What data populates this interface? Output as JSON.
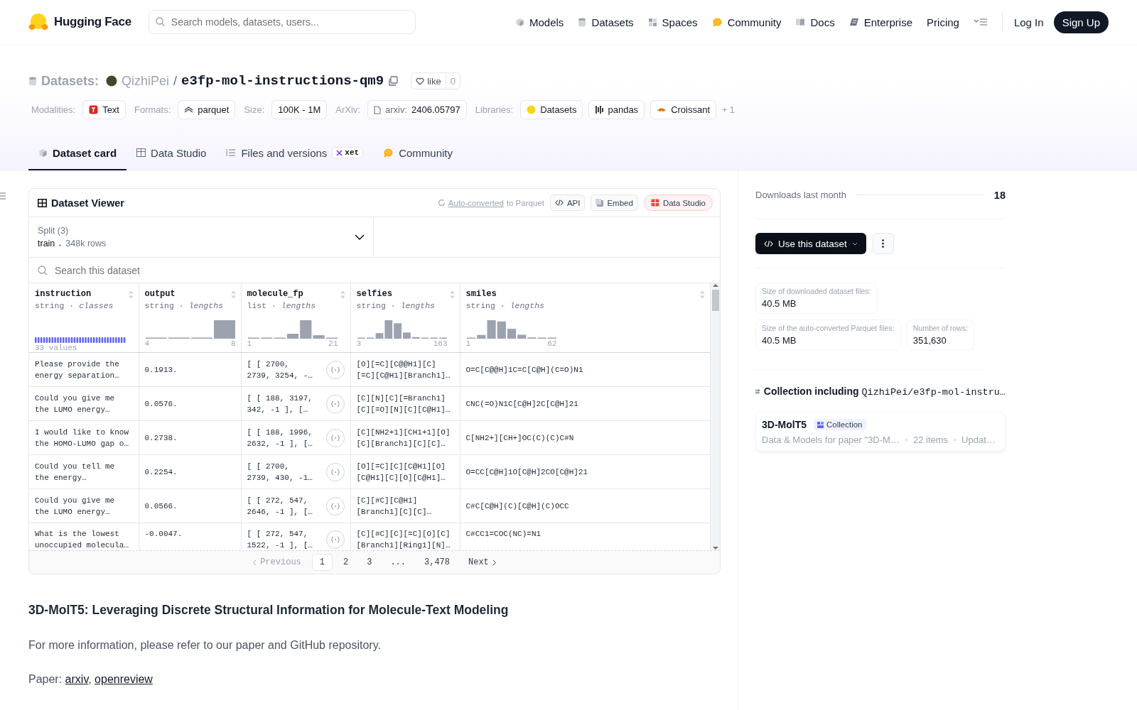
{
  "nav": {
    "logo": "Hugging Face",
    "search": {
      "placeholder": "Search models, datasets, users..."
    },
    "links": [
      "Models",
      "Datasets",
      "Spaces",
      "Community",
      "Docs",
      "Enterprise",
      "Pricing"
    ],
    "login": "Log In",
    "signup": "Sign Up"
  },
  "header": {
    "section": "Datasets:",
    "owner": "QizhiPei",
    "separator": "/",
    "name": "e3fp-mol-instructions-qm9",
    "like": {
      "label": "like",
      "count": "0"
    },
    "tag_groups": [
      {
        "label": "Modalities:",
        "chips": [
          {
            "text": "Text"
          }
        ]
      },
      {
        "label": "Formats:",
        "chips": [
          {
            "text": "parquet"
          }
        ]
      },
      {
        "label": "Size:",
        "chips": [
          {
            "text": "100K - 1M"
          }
        ]
      },
      {
        "label": "ArXiv:",
        "chips": [
          {
            "prefix": "arxiv:",
            "text": "2406.05797"
          }
        ]
      },
      {
        "label": "Libraries:",
        "chips": [
          {
            "text": "Datasets"
          },
          {
            "text": "pandas"
          },
          {
            "text": "Croissant"
          }
        ]
      }
    ],
    "more": "+ 1"
  },
  "tabs": [
    {
      "label": "Dataset card",
      "selected": true
    },
    {
      "label": "Data Studio",
      "selected": false
    },
    {
      "label": "Files and versions",
      "selected": false,
      "badge": "xet"
    },
    {
      "label": "Community",
      "selected": false
    }
  ],
  "viewer": {
    "title": "Dataset Viewer",
    "converted_link": "Auto-converted",
    "converted_text": "to Parquet",
    "buttons": [
      "API",
      "Embed",
      "Data Studio"
    ],
    "split": {
      "label": "Split (3)",
      "value": "train",
      "rows": "348k rows"
    },
    "search": {
      "placeholder": "Search this dataset"
    },
    "columns": [
      {
        "name": "instruction",
        "type": "string · *classes*",
        "kind": "classes",
        "summary": "33 values",
        "expandable": false
      },
      {
        "name": "output",
        "type": "string · *lengths*",
        "kind": "histogram",
        "min": "4",
        "max": "8",
        "expandable": false
      },
      {
        "name": "molecule_fp",
        "type": "list · *lengths*",
        "kind": "histogram",
        "min": "1",
        "max": "21",
        "expandable": true
      },
      {
        "name": "selfies",
        "type": "string · *lengths*",
        "kind": "histogram",
        "min": "3",
        "max": "163",
        "expandable": false
      },
      {
        "name": "smiles",
        "type": "string · *lengths*",
        "kind": "histogram",
        "min": "1",
        "max": "62",
        "expandable": false
      }
    ],
    "rows": [
      [
        "Please provide the\nenergy separation…",
        "0.1913.",
        "[ [ 2700,\n2739, 3254, -…",
        "[O][=C][C@@H1][C]\n[=C][C@H1][Branch1]…",
        "O=C[C@@H]1C=C[C@H](C=O)N1"
      ],
      [
        "Could you give me\nthe LUMO energy…",
        "0.0576.",
        "[ [ 188, 3197,\n342, -1 ], […",
        "[C][N][C][=Branch1]\n[C][=O][N][C][C@H1]…",
        "CNC(=O)N1C[C@H]2C[C@H]21"
      ],
      [
        "I would like to know\nthe HOMO-LUMO gap o…",
        "0.2738.",
        "[ [ 188, 1996,\n2632, -1 ], […",
        "[C][NH2+1][CH1+1][O]\n[C][Branch1][C][C]…",
        "C[NH2+][CH+]OC(C)(C)C#N"
      ],
      [
        "Could you tell me\nthe energy…",
        "0.2254.",
        "[ [ 2700,\n2739, 430, -1…",
        "[O][=C][C][C@H1][O]\n[C@H1][C][O][C@H1]…",
        "O=CC[C@H]1O[C@H]2CO[C@H]21"
      ],
      [
        "Could you give me\nthe LUMO energy…",
        "0.0566.",
        "[ [ 272, 547,\n2646, -1 ], […",
        "[C][#C][C@H1]\n[Branch1][C][C]…",
        "C#C[C@H](C)[C@H](C)OCC"
      ],
      [
        "What is the lowest\nunoccupied molecula…",
        "-0.0047.",
        "[ [ 272, 547,\n1522, -1 ], […",
        "[C][#C][C][=C][O][C]\n[Branch1][Ring1][N]…",
        "C#CC1=COC(NC)=N1"
      ]
    ],
    "pagination": {
      "previous": {
        "label": "Previous",
        "disabled": true
      },
      "pages": [
        {
          "label": "1",
          "selected": true
        },
        {
          "label": "2",
          "selected": false
        },
        {
          "label": "3",
          "selected": false
        },
        {
          "label": "...",
          "selected": false
        },
        {
          "label": "3,478",
          "selected": false
        }
      ],
      "next": {
        "label": "Next",
        "disabled": false
      }
    }
  },
  "sidebar": {
    "downloads": {
      "label": "Downloads last month",
      "value": "18"
    },
    "use_button": "Use this dataset",
    "stats": [
      {
        "label": "Size of downloaded dataset files:",
        "value": "40.5 MB"
      },
      {
        "label": "Size of the auto-converted Parquet files:",
        "value": "40.5 MB"
      },
      {
        "label": "Number of rows:",
        "value": "351,630"
      }
    ],
    "collection": {
      "heading": "Collection including",
      "repo": "QizhiPei/e3fp-mol-instru…",
      "card": {
        "title": "3D-MolT5",
        "badge": "Collection",
        "description": "Data & Models for paper \"3D-M…",
        "items": "22 items",
        "updated": "Updat…"
      }
    }
  },
  "readme": {
    "title": "3D-MolT5: Leveraging Discrete Structural Information for Molecule-Text Modeling",
    "paragraph": "For more information, please refer to our paper and GitHub repository.",
    "paper": {
      "label": "Paper:",
      "links": [
        "arxiv",
        "openreview"
      ],
      "separator": ", "
    }
  }
}
